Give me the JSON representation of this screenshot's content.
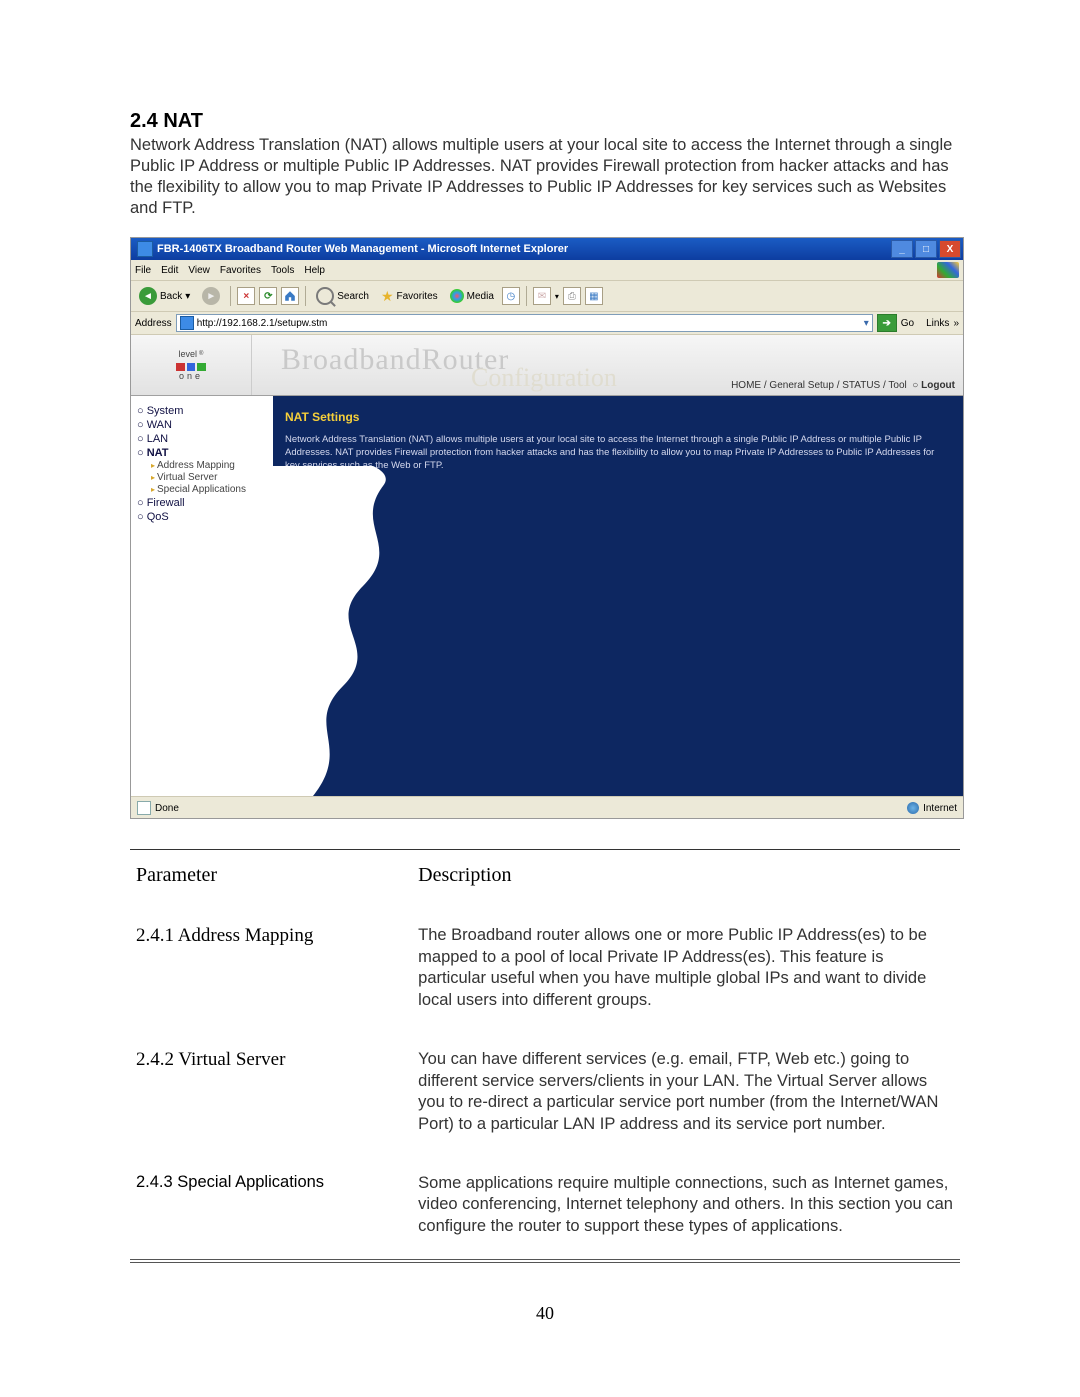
{
  "section": {
    "heading": "2.4 NAT",
    "intro": "Network Address Translation (NAT) allows multiple users at your local site to access the Internet through a single Public IP Address or multiple Public IP Addresses. NAT provides Firewall protection from hacker attacks and has the flexibility to allow you to map Private IP Addresses to Public IP Addresses for key services such as Websites and FTP."
  },
  "browser": {
    "title": "FBR-1406TX Broadband Router Web Management - Microsoft Internet Explorer",
    "menu": [
      "File",
      "Edit",
      "View",
      "Favorites",
      "Tools",
      "Help"
    ],
    "toolbar": {
      "back": "Back",
      "search": "Search",
      "favorites": "Favorites",
      "media": "Media"
    },
    "address_label": "Address",
    "address_url": "http://192.168.2.1/setupw.stm",
    "go": "Go",
    "links": "Links",
    "status_done": "Done",
    "status_zone": "Internet"
  },
  "router_header": {
    "logo_top": "level",
    "logo_bottom": "one",
    "title": "BroadbandRouter",
    "subtitle": "Configuration",
    "nav": [
      "HOME",
      "General Setup",
      "STATUS",
      "Tool"
    ],
    "logout": "Logout"
  },
  "sidebar": {
    "items": [
      {
        "label": "System"
      },
      {
        "label": "WAN"
      },
      {
        "label": "LAN"
      },
      {
        "label": "NAT",
        "children": [
          "Address Mapping",
          "Virtual Server",
          "Special Applications"
        ]
      },
      {
        "label": "Firewall"
      },
      {
        "label": "QoS"
      }
    ]
  },
  "main_panel": {
    "heading": "NAT Settings",
    "body": "Network Address Translation (NAT) allows multiple users at your local site to access the Internet through a single Public IP Address or multiple Public IP Addresses. NAT provides Firewall protection from hacker attacks and has the flexibility to allow you to map Private IP Addresses to Public IP Addresses for key services such as the Web or FTP."
  },
  "table": {
    "head_param": "Parameter",
    "head_desc": "Description",
    "rows": [
      {
        "param": "2.4.1 Address Mapping",
        "desc": "The Broadband router allows one or more Public IP Address(es) to be mapped to a pool of local Private IP Address(es). This feature is particular useful when you have multiple global IPs and want to divide local users into different groups."
      },
      {
        "param": "2.4.2 Virtual Server",
        "desc": "You can have different services (e.g. email, FTP, Web etc.) going to different service servers/clients in your LAN. The Virtual Server allows you to re-direct a particular service port number (from the Internet/WAN Port) to a particular LAN IP address and its service port number."
      },
      {
        "param": "2.4.3 Special Applications",
        "desc": "Some applications require multiple connections, such as Internet games, video conferencing, Internet telephony and others. In this section you can configure the router to support these types of applications."
      }
    ]
  },
  "page_number": "40"
}
